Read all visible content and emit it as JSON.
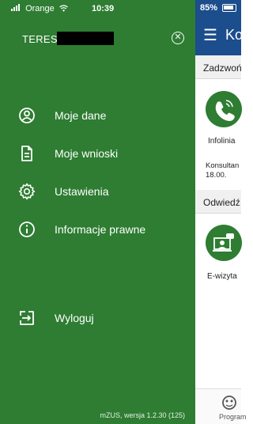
{
  "status_bar": {
    "carrier": "Orange",
    "time": "10:39",
    "battery": "85%"
  },
  "drawer": {
    "user_name": "TERESA",
    "menu": [
      {
        "label": "Moje dane",
        "icon": "account-circle-icon"
      },
      {
        "label": "Moje wnioski",
        "icon": "document-icon"
      },
      {
        "label": "Ustawienia",
        "icon": "settings-gear-icon"
      },
      {
        "label": "Informacje prawne",
        "icon": "info-icon"
      },
      {
        "label": "Wyloguj",
        "icon": "logout-icon"
      }
    ],
    "version": "mZUS, wersja 1.2.30 (125)"
  },
  "main": {
    "title": "Ko",
    "section1": {
      "header": "Zadzwoń",
      "tile_label": "Infolinia",
      "text": "Konsultan",
      "text2": "18.00."
    },
    "section2": {
      "header": "Odwiedź",
      "tile_label": "E-wizyta"
    },
    "bottom_nav": {
      "label": "Program"
    }
  },
  "colors": {
    "drawer_green": "#2e7d32",
    "header_blue": "#1c4d8c"
  }
}
